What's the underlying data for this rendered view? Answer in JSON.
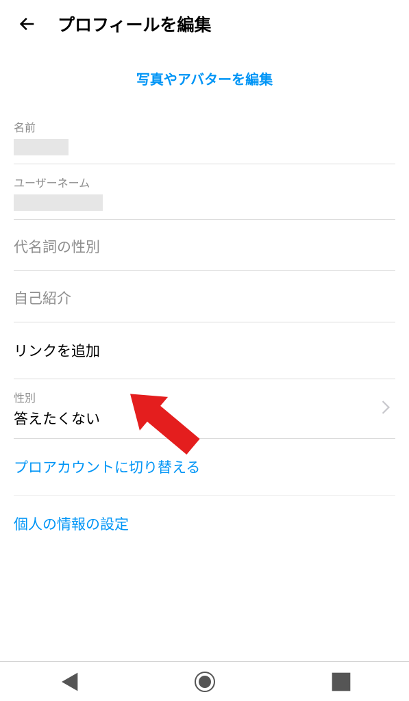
{
  "header": {
    "title": "プロフィールを編集"
  },
  "editPhotoLink": "写真やアバターを編集",
  "fields": {
    "name": {
      "label": "名前"
    },
    "username": {
      "label": "ユーザーネーム"
    },
    "pronouns": {
      "label": "代名詞の性別"
    },
    "bio": {
      "label": "自己紹介"
    },
    "addLink": "リンクを追加",
    "gender": {
      "label": "性別",
      "value": "答えたくない"
    }
  },
  "links": {
    "switchToPro": "プロアカウントに切り替える",
    "personalInfo": "個人の情報の設定"
  }
}
